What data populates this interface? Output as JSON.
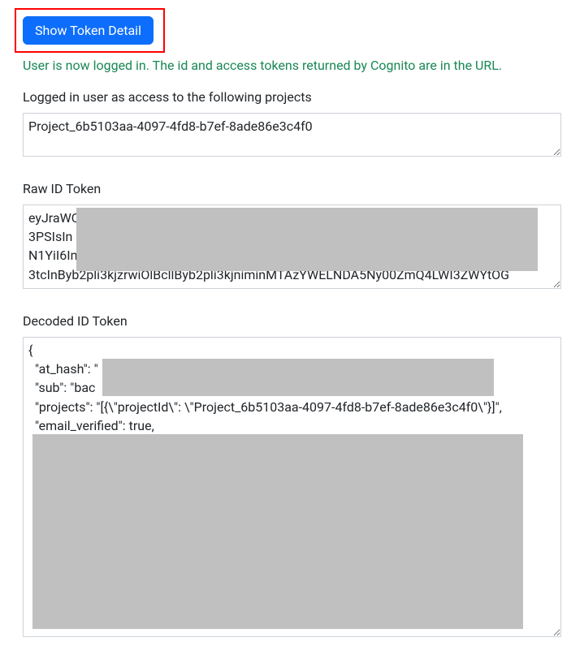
{
  "button": {
    "show_token_label": "Show Token Detail"
  },
  "status": {
    "logged_in_message": "User is now logged in. The id and access tokens returned by Cognito are in the URL."
  },
  "projects": {
    "label": "Logged in user as access to the following projects",
    "value": "Project_6b5103aa-4097-4fd8-b7ef-8ade86e3c4f0"
  },
  "raw_token": {
    "label": "Raw ID Token",
    "value": "eyJraWC                                                                                                         eWR\n3PSIsIn                                                                                                            yIsIn\nN1YiI6In                                                                                                           oiW\n3tcInByb2pli3kjzrwiOlBcllByb2pli3kjniminMTAzYWELNDA5Ny00ZmQ4LWI3ZWYtOG"
  },
  "decoded_token": {
    "label": "Decoded ID Token",
    "value": "{\n  \"at_hash\": \"\n  \"sub\": \"bac\n  \"projects\": \"[{\\\"projectId\\\": \\\"Project_6b5103aa-4097-4fd8-b7ef-8ade86e3c4f0\\\"}]\",\n  \"email_verified\": true,\n\n\n\n\n\n\n\n\n\n"
  }
}
